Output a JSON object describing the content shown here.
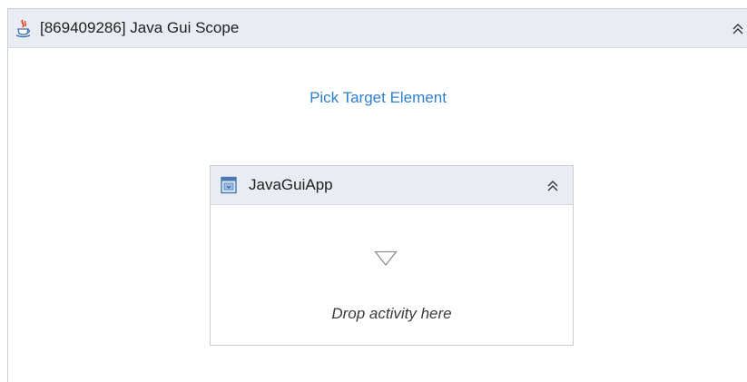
{
  "scope": {
    "title": "[869409286] Java Gui Scope",
    "icon": "java-icon",
    "collapse_icon": "double-chevron-up-icon",
    "pick_target_label": "Pick Target Element"
  },
  "app": {
    "title": "JavaGuiApp",
    "icon": "window-app-icon",
    "collapse_icon": "double-chevron-up-icon",
    "drop_icon": "triangle-down-icon",
    "drop_label": "Drop activity here"
  },
  "colors": {
    "header_bg": "#e9edf3",
    "border": "#c9ccd2",
    "link": "#2f7fd1"
  }
}
